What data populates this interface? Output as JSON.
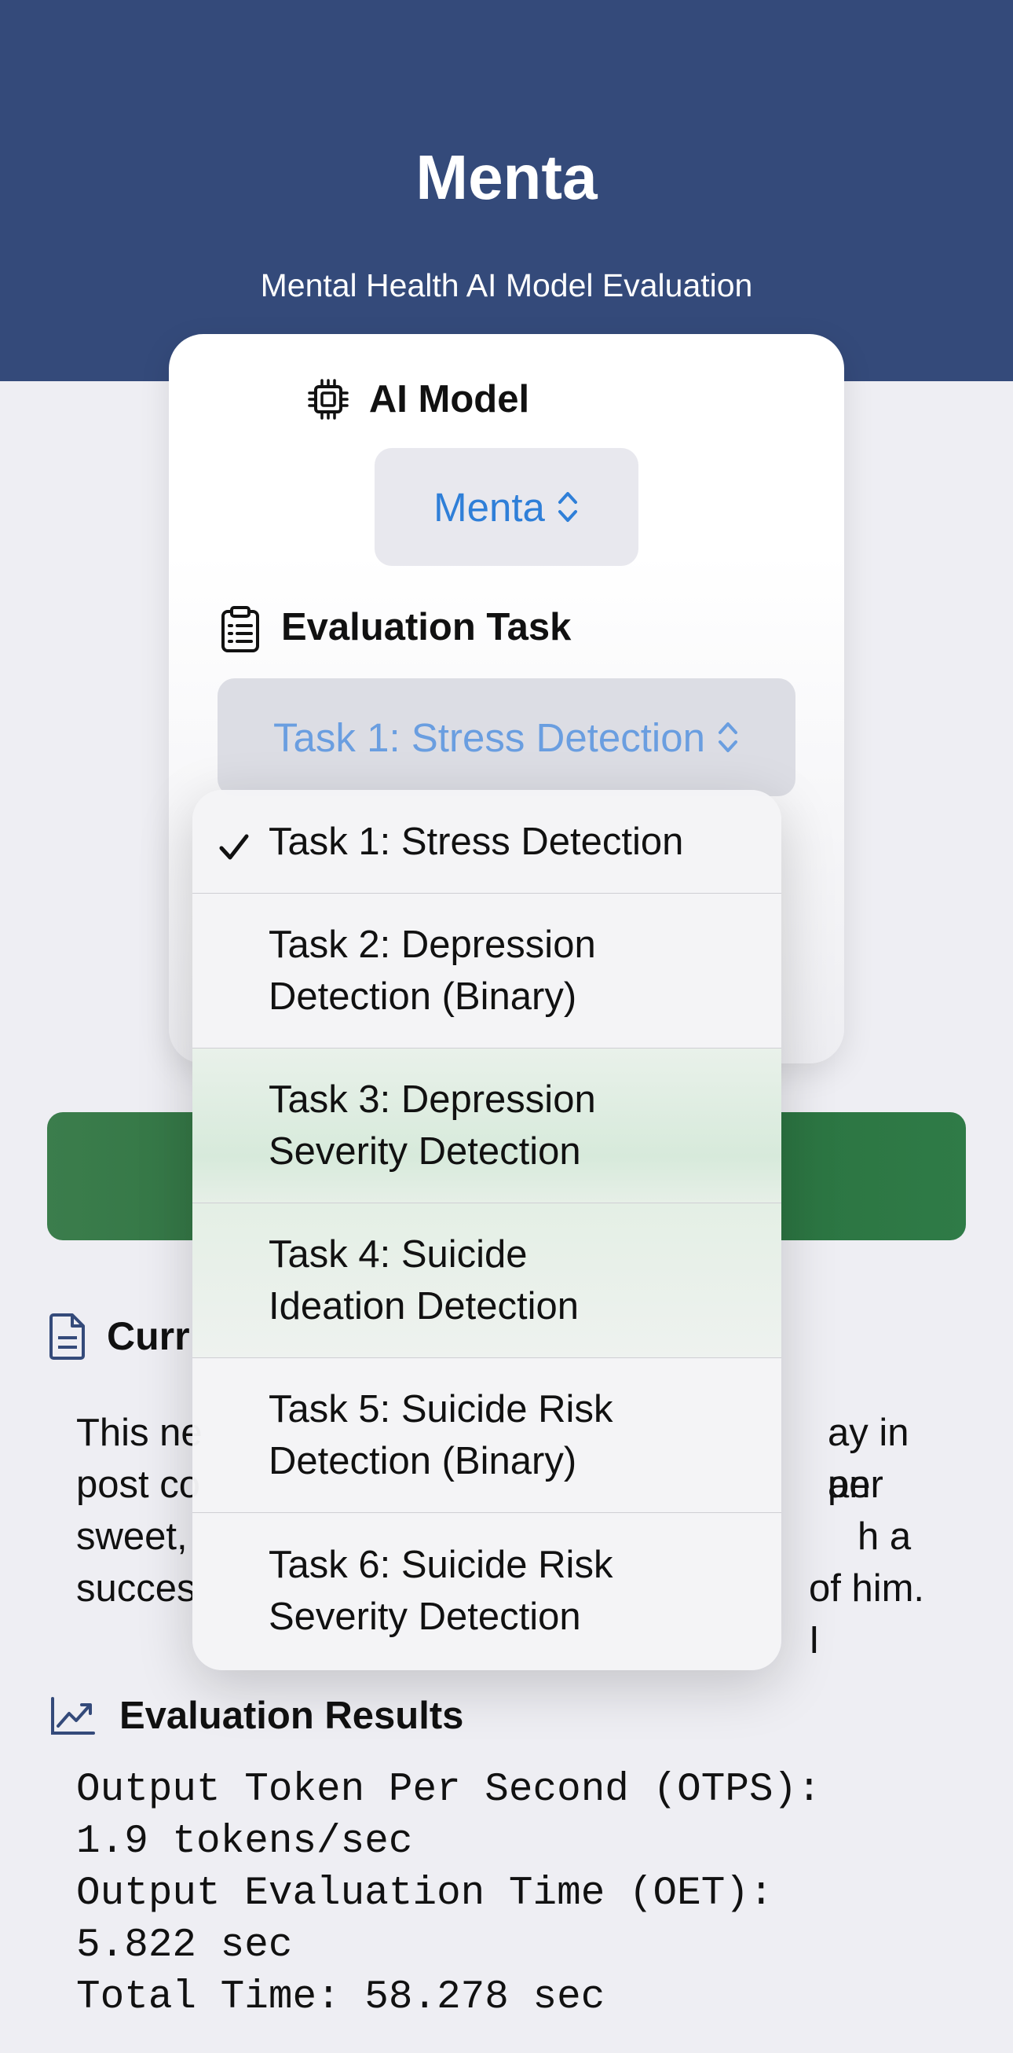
{
  "header": {
    "title": "Menta",
    "subtitle": "Mental Health AI Model Evaluation"
  },
  "model_section": {
    "heading": "AI Model",
    "icon": "cpu-chip-icon",
    "selected": "Menta"
  },
  "task_section": {
    "heading": "Evaluation Task",
    "icon": "clipboard-list-icon",
    "selected": "Task 1: Stress Detection"
  },
  "dropdown": {
    "items": [
      {
        "label": "Task 1: Stress Detection",
        "checked": true
      },
      {
        "label": "Task 2: Depression Detection (Binary)",
        "checked": false
      },
      {
        "label": "Task 3: Depression Severity Detection",
        "checked": false
      },
      {
        "label": "Task 4: Suicide Ideation Detection",
        "checked": false
      },
      {
        "label": "Task 5: Suicide Risk Detection (Binary)",
        "checked": false
      },
      {
        "label": "Task 6: Suicide Risk Severity Detection",
        "checked": false
      }
    ]
  },
  "current_section": {
    "heading_visible": "Curr",
    "icon": "document-icon",
    "post_lines": [
      {
        "left": "This ne",
        "right": "ay in an"
      },
      {
        "left": "post co",
        "right": "per"
      },
      {
        "left": "sweet,",
        "right": "h a"
      },
      {
        "left": "succes",
        "right": "of him. I"
      }
    ]
  },
  "results": {
    "heading": "Evaluation Results",
    "icon": "chart-line-icon",
    "lines": [
      "Output Token Per Second (OTPS):",
      "1.9 tokens/sec",
      "Output Evaluation Time (OET):",
      "5.822 sec",
      "Total Time: 58.278 sec"
    ]
  },
  "colors": {
    "header_bg": "#344a7a",
    "accent": "#2f7fd8",
    "run_button": "#2a7040",
    "background": "#eeeef3"
  }
}
